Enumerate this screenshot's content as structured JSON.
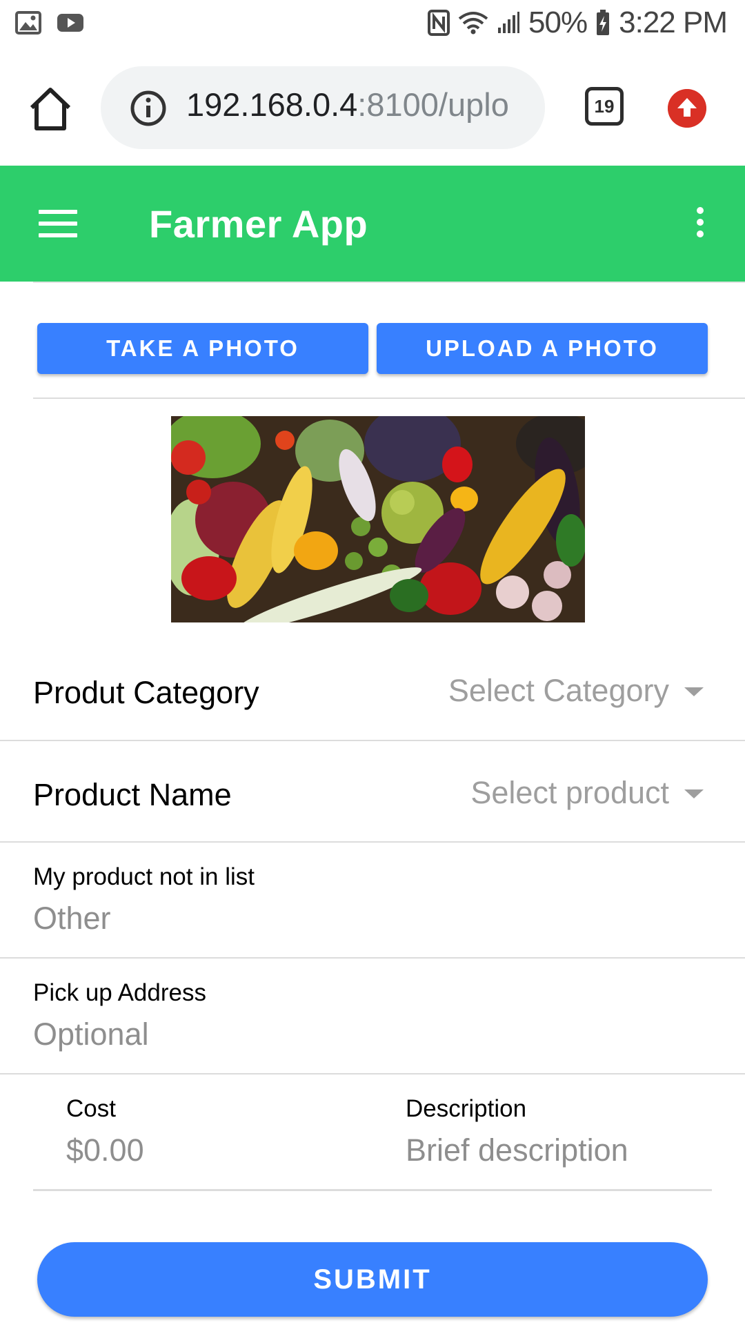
{
  "status_bar": {
    "battery": "50%",
    "time": "3:22 PM"
  },
  "browser": {
    "url_host": "192.168.0.4",
    "url_path": ":8100/uplo",
    "tab_count": "19"
  },
  "toolbar": {
    "title": "Farmer App",
    "color": "#2dce6b"
  },
  "photo_buttons": {
    "take": "TAKE A PHOTO",
    "upload": "UPLOAD A PHOTO"
  },
  "form": {
    "category": {
      "label": "Produt Category",
      "placeholder": "Select Category"
    },
    "product": {
      "label": "Product Name",
      "placeholder": "Select product"
    },
    "other": {
      "label": "My product not in list",
      "placeholder": "Other"
    },
    "address": {
      "label": "Pick up Address",
      "placeholder": "Optional"
    },
    "cost": {
      "label": "Cost",
      "placeholder": "$0.00"
    },
    "description": {
      "label": "Description",
      "placeholder": "Brief description"
    }
  },
  "submit": {
    "label": "SUBMIT"
  },
  "colors": {
    "primary": "#3880ff",
    "toolbar": "#2dce6b",
    "update_badge": "#d93025"
  }
}
